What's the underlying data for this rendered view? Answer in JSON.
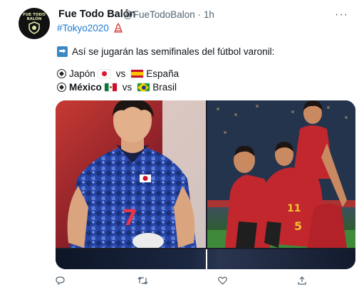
{
  "tweet": {
    "avatar_text": "FUE TODO BALÓN",
    "author_name": "Fue Todo Balón",
    "handle": "@FueTodoBalon",
    "separator": "·",
    "time": "1h",
    "hashtag": "#Tokyo2020",
    "headline": "Así se jugarán las semifinales del fútbol varonil:",
    "matches": [
      {
        "team_a": "Japón",
        "vs": "vs",
        "team_b": "España"
      },
      {
        "team_a": "México",
        "vs": "vs",
        "team_b": "Brasil"
      }
    ]
  },
  "media": {
    "left_photo_jersey_number": "7",
    "right_photo_jersey_numbers": [
      "11",
      "5"
    ]
  },
  "icons": {
    "more": "more-options-icon",
    "reply": "reply-icon",
    "retweet": "retweet-icon",
    "like": "like-icon",
    "share": "share-icon"
  },
  "colors": {
    "link": "#1d7bd6",
    "secondary_text": "#536471",
    "japan_kit": "#1f3f9c",
    "spain_kit": "#c1272d"
  }
}
